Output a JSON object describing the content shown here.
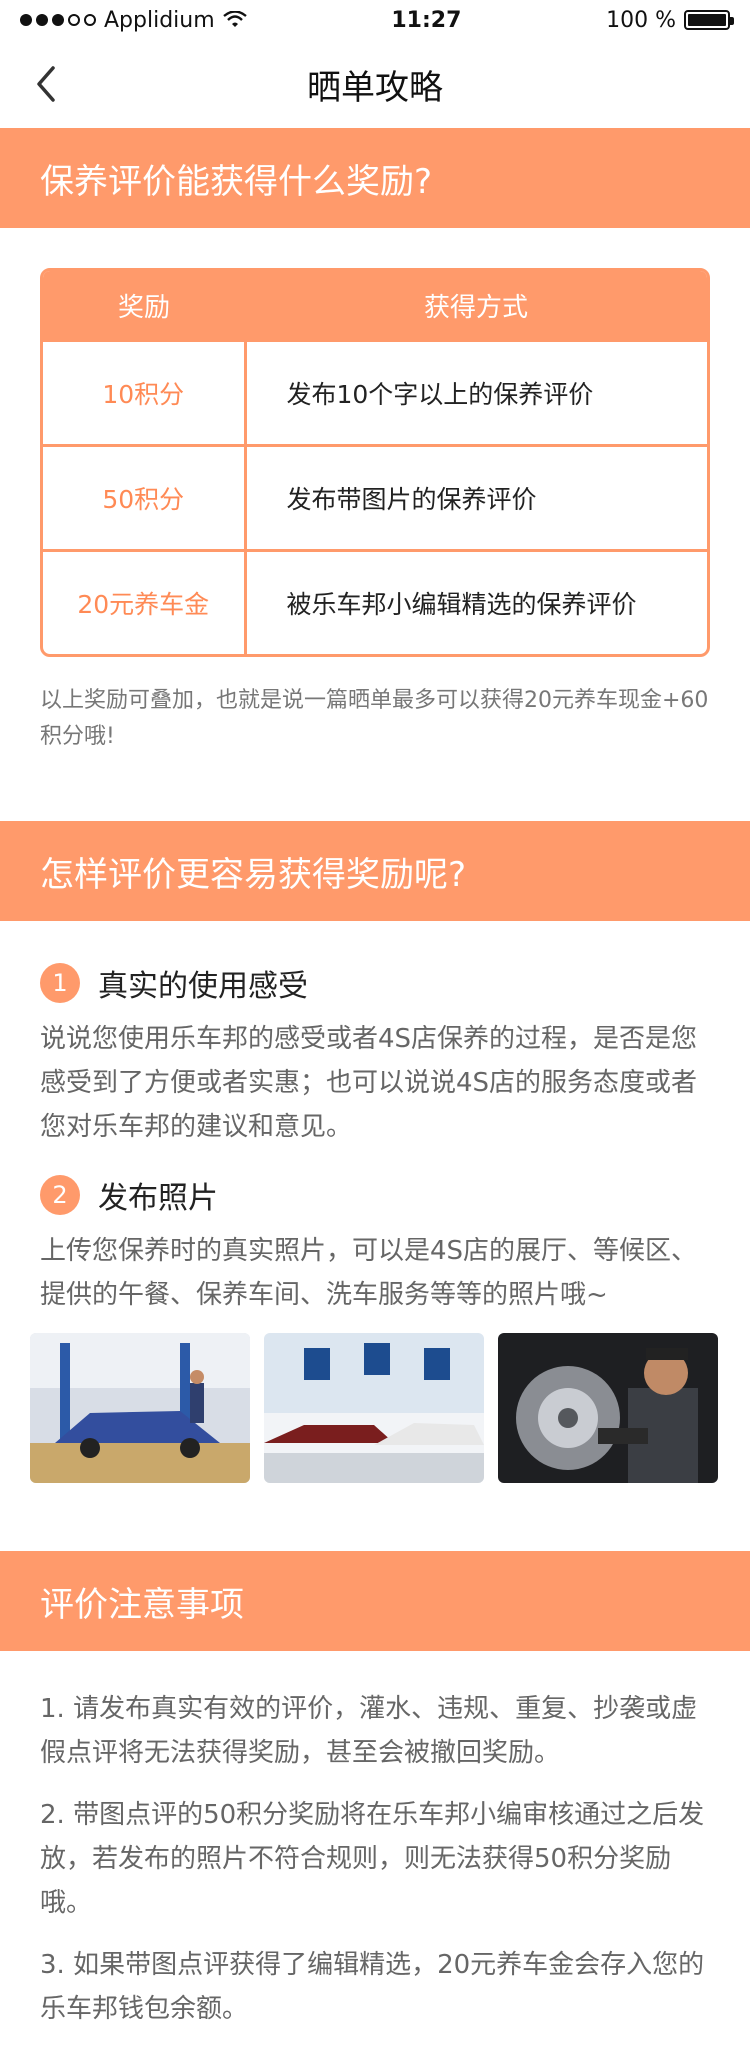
{
  "status": {
    "carrier": "Applidium",
    "time": "11:27",
    "battery": "100 %"
  },
  "nav": {
    "title": "晒单攻略"
  },
  "section1": {
    "header": "保养评价能获得什么奖励?",
    "table": {
      "headers": [
        "奖励",
        "获得方式"
      ],
      "rows": [
        {
          "reward": "10积分",
          "method": "发布10个字以上的保养评价"
        },
        {
          "reward": "50积分",
          "method": "发布带图片的保养评价"
        },
        {
          "reward": "20元养车金",
          "method": "被乐车邦小编辑精选的保养评价"
        }
      ]
    },
    "note": "以上奖励可叠加，也就是说一篇晒单最多可以获得20元养车现金+60积分哦!"
  },
  "section2": {
    "header": "怎样评价更容易获得奖励呢?",
    "tips": [
      {
        "num": "1",
        "title": "真实的使用感受",
        "text": "说说您使用乐车邦的感受或者4S店保养的过程，是否是您感受到了方便或者实惠；也可以说说4S店的服务态度或者您对乐车邦的建议和意见。"
      },
      {
        "num": "2",
        "title": "发布照片",
        "text": "上传您保养时的真实照片，可以是4S店的展厅、等候区、提供的午餐、保养车间、洗车服务等等的照片哦~"
      }
    ]
  },
  "section3": {
    "header": "评价注意事项",
    "items": [
      "1. 请发布真实有效的评价，灌水、违规、重复、抄袭或虚假点评将无法获得奖励，甚至会被撤回奖励。",
      "2. 带图点评的50积分奖励将在乐车邦小编审核通过之后发放，若发布的照片不符合规则，则无法获得50积分奖励哦。",
      "3. 如果带图点评获得了编辑精选，20元养车金会存入您的乐车邦钱包余额。"
    ]
  },
  "icons": {
    "back": "chevron-left-icon",
    "wifi": "wifi-icon",
    "battery": "battery-icon"
  },
  "colors": {
    "accent": "#ff9a6b",
    "reward_text": "#ff8a55"
  }
}
